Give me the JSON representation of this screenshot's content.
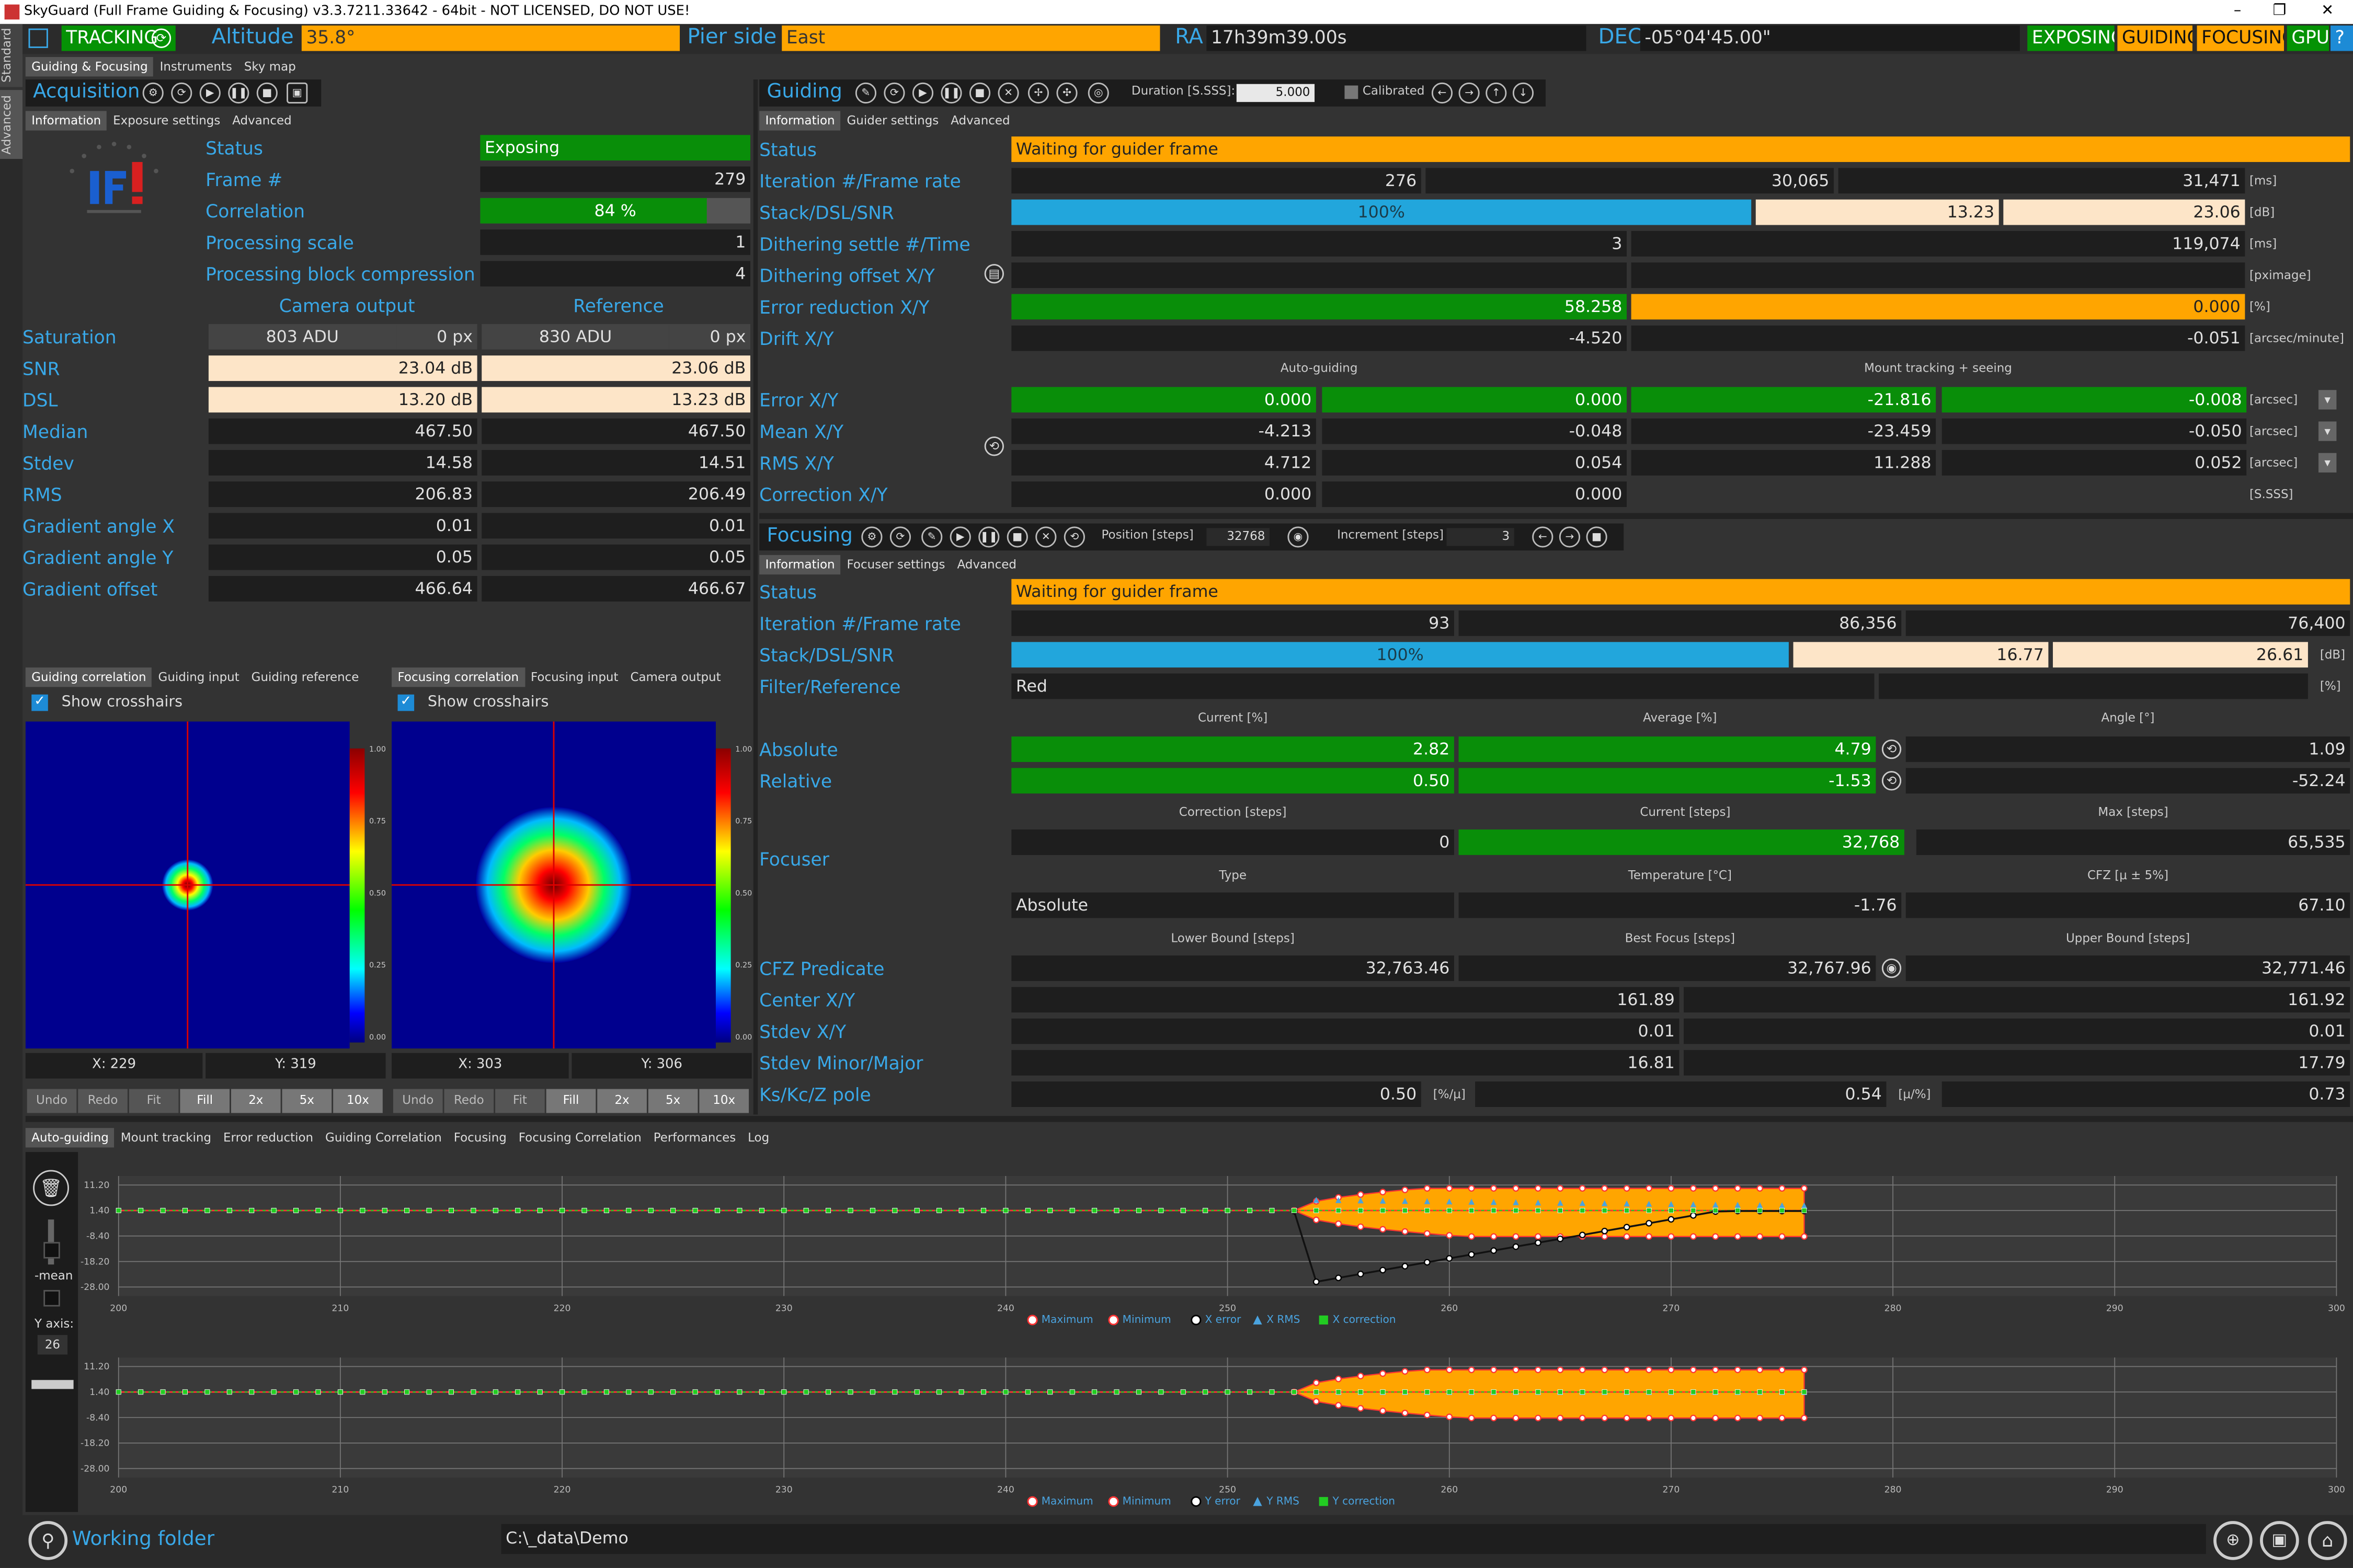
{
  "window": {
    "title": "SkyGuard (Full Frame Guiding & Focusing) v3.3.7211.33642 - 64bit - NOT LICENSED, DO NOT USE!"
  },
  "top": {
    "tracking": "TRACKING",
    "altitude_label": "Altitude",
    "altitude": "35.8°",
    "pier_label": "Pier side",
    "pier": "East",
    "ra_label": "RA",
    "ra": "17h39m39.00s",
    "dec_label": "DEC",
    "dec": "-05°04'45.00\"",
    "badges": [
      "EXPOSING",
      "GUIDING",
      "FOCUSING",
      "GPU"
    ]
  },
  "side_tabs": [
    "Standard",
    "Advanced"
  ],
  "main_tabs": [
    "Guiding & Focusing",
    "Instruments",
    "Sky map"
  ],
  "acq": {
    "title": "Acquisition",
    "tabs": [
      "Information",
      "Exposure settings",
      "Advanced"
    ],
    "status_label": "Status",
    "status": "Exposing",
    "frame_label": "Frame #",
    "frame": "279",
    "corr_label": "Correlation",
    "corr": "84 %",
    "corr_fraction": 0.84,
    "pscale_label": "Processing scale",
    "pscale": "1",
    "pblock_label": "Processing block compression",
    "pblock": "4",
    "cam_hdr": "Camera output",
    "ref_hdr": "Reference",
    "rows": [
      {
        "label": "Saturation",
        "a": "803 ADU",
        "a2": "0 px",
        "b": "830 ADU",
        "b2": "0 px"
      },
      {
        "label": "SNR",
        "a": "23.04 dB",
        "b": "23.06 dB"
      },
      {
        "label": "DSL",
        "a": "13.20 dB",
        "b": "13.23 dB"
      },
      {
        "label": "Median",
        "a": "467.50",
        "b": "467.50"
      },
      {
        "label": "Stdev",
        "a": "14.58",
        "b": "14.51"
      },
      {
        "label": "RMS",
        "a": "206.83",
        "b": "206.49"
      },
      {
        "label": "Gradient angle X",
        "a": "0.01",
        "b": "0.01"
      },
      {
        "label": "Gradient angle Y",
        "a": "0.05",
        "b": "0.05"
      },
      {
        "label": "Gradient offset",
        "a": "466.64",
        "b": "466.67"
      }
    ]
  },
  "guiding": {
    "title": "Guiding",
    "duration_label": "Duration [S.SSS]:",
    "duration": "5.000",
    "calibrated": "Calibrated",
    "tabs": [
      "Information",
      "Guider settings",
      "Advanced"
    ],
    "status_label": "Status",
    "status": "Waiting for guider frame",
    "iter_label": "Iteration #/Frame rate",
    "iter": [
      "276",
      "30,065",
      "31,471"
    ],
    "iter_unit": "[ms]",
    "stack_label": "Stack/DSL/SNR",
    "stack": [
      "100%",
      "13.23",
      "23.06"
    ],
    "stack_unit": "[dB]",
    "dither_label": "Dithering settle #/Time",
    "dither": [
      "3",
      "119,074"
    ],
    "dither_unit": "[ms]",
    "doffset_label": "Dithering offset X/Y",
    "doffset_unit": "[pximage]",
    "errred_label": "Error reduction X/Y",
    "errred": [
      "58.258",
      "0.000"
    ],
    "errred_unit": "[%]",
    "drift_label": "Drift X/Y",
    "drift": [
      "-4.520",
      "-0.051"
    ],
    "drift_unit": "[arcsec/minute]",
    "hdr_auto": "Auto-guiding",
    "hdr_mount": "Mount tracking + seeing",
    "rows": [
      {
        "label": "Error X/Y",
        "v": [
          "0.000",
          "0.000",
          "-21.816",
          "-0.008"
        ],
        "unit": "[arcsec]"
      },
      {
        "label": "Mean X/Y",
        "v": [
          "-4.213",
          "-0.048",
          "-23.459",
          "-0.050"
        ],
        "unit": "[arcsec]"
      },
      {
        "label": "RMS X/Y",
        "v": [
          "4.712",
          "0.054",
          "11.288",
          "0.052"
        ],
        "unit": "[arcsec]"
      },
      {
        "label": "Correction X/Y",
        "v": [
          "0.000",
          "0.000"
        ],
        "unit": "[S.SSS]"
      }
    ]
  },
  "focusing": {
    "title": "Focusing",
    "position_label": "Position [steps]",
    "position": "32768",
    "increment_label": "Increment [steps]",
    "increment": "3",
    "tabs": [
      "Information",
      "Focuser settings",
      "Advanced"
    ],
    "status_label": "Status",
    "status": "Waiting for guider frame",
    "iter_label": "Iteration #/Frame rate",
    "iter": [
      "93",
      "86,356",
      "76,400"
    ],
    "stack_label": "Stack/DSL/SNR",
    "stack": [
      "100%",
      "16.77",
      "26.61"
    ],
    "stack_unit": "[dB]",
    "filter_label": "Filter/Reference",
    "filter": "Red",
    "filter_unit": "[%]",
    "hdr_current": "Current [%]",
    "hdr_average": "Average [%]",
    "hdr_angle": "Angle [°]",
    "absolute_label": "Absolute",
    "absolute": [
      "2.82",
      "4.79",
      "1.09"
    ],
    "relative_label": "Relative",
    "relative": [
      "0.50",
      "-1.53",
      "-52.24"
    ],
    "hdr_corr": "Correction [steps]",
    "hdr_cur": "Current [steps]",
    "hdr_max": "Max [steps]",
    "focuser_label": "Focuser",
    "focuser": [
      "0",
      "32,768",
      "65,535"
    ],
    "hdr_type": "Type",
    "hdr_temp": "Temperature [°C]",
    "hdr_cfz": "CFZ [μ ± 5%]",
    "ftype": [
      "Absolute",
      "-1.76",
      "67.10"
    ],
    "hdr_lower": "Lower Bound [steps]",
    "hdr_best": "Best Focus [steps]",
    "hdr_upper": "Upper Bound [steps]",
    "cfz_label": "CFZ Predicate",
    "cfz": [
      "32,763.46",
      "32,767.96",
      "32,771.46"
    ],
    "center_label": "Center X/Y",
    "center": [
      "161.89",
      "161.92"
    ],
    "stdev_label": "Stdev X/Y",
    "stdev": [
      "0.01",
      "0.01"
    ],
    "stdevmm_label": "Stdev Minor/Major",
    "stdevmm": [
      "16.81",
      "17.79"
    ],
    "kskc_label": "Ks/Kc/Z pole",
    "kskc": [
      "0.50",
      "0.54",
      "0.73"
    ],
    "kskc_u1": "[%/μ]",
    "kskc_u2": "[μ/%]"
  },
  "viewers": {
    "left_tabs": [
      "Guiding correlation",
      "Guiding input",
      "Guiding reference"
    ],
    "right_tabs": [
      "Focusing correlation",
      "Focusing input",
      "Camera output"
    ],
    "crosshairs": "Show crosshairs",
    "left_x": "X: 229",
    "left_y": "Y: 319",
    "right_x": "X: 303",
    "right_y": "Y: 306",
    "scale_ticks": [
      "1.00",
      "0.75",
      "0.50",
      "0.25",
      "0.00"
    ],
    "buttons": [
      "Undo",
      "Redo",
      "Fit",
      "Fill",
      "2x",
      "5x",
      "10x"
    ]
  },
  "charts_tabs": [
    "Auto-guiding",
    "Mount tracking",
    "Error reduction",
    "Guiding Correlation",
    "Focusing",
    "Focusing Correlation",
    "Performances",
    "Log"
  ],
  "chart_panel": {
    "mean_label": "-mean",
    "yaxis_label": "Y axis:",
    "yaxis": "26"
  },
  "chart_data": [
    {
      "type": "line",
      "ylim": [
        -28.0,
        11.2
      ],
      "yticks": [
        "11.20",
        "1.40",
        "-8.40",
        "-18.20",
        "-28.00"
      ],
      "xticks": [
        "200",
        "210",
        "220",
        "230",
        "240",
        "250",
        "260",
        "270",
        "280",
        "290",
        "300"
      ],
      "legend": [
        "Maximum",
        "Minimum",
        "X error",
        "X RMS",
        "X correction"
      ],
      "colors": {
        "band": "#ffa500",
        "error": "#111111",
        "rms": "#4aa3df",
        "correction": "#22cc22",
        "limit": "#ff3333"
      }
    },
    {
      "type": "line",
      "ylim": [
        -28.0,
        11.2
      ],
      "yticks": [
        "11.20",
        "1.40",
        "-8.40",
        "-18.20",
        "-28.00"
      ],
      "xticks": [
        "200",
        "210",
        "220",
        "230",
        "240",
        "250",
        "260",
        "270",
        "280",
        "290",
        "300"
      ],
      "legend": [
        "Maximum",
        "Minimum",
        "Y error",
        "Y RMS",
        "Y correction"
      ],
      "colors": {
        "band": "#ffa500",
        "error": "#111111",
        "rms": "#4aa3df",
        "correction": "#22cc22",
        "limit": "#ff3333"
      }
    }
  ],
  "footer": {
    "label": "Working folder",
    "path": "C:\\_data\\Demo"
  }
}
